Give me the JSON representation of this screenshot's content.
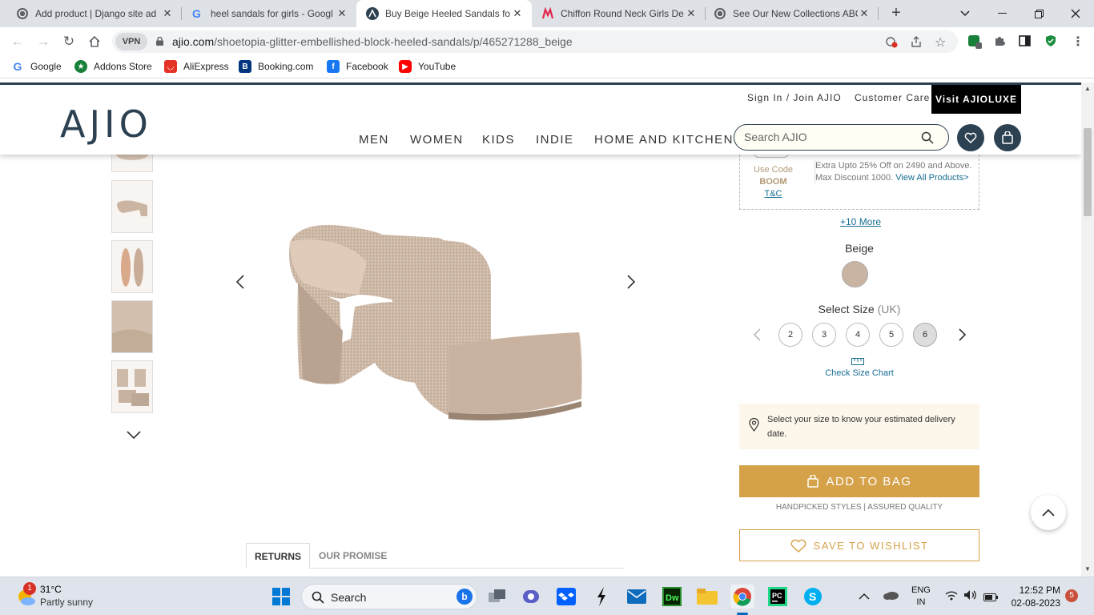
{
  "browser": {
    "tabs": [
      {
        "title": "Add product | Django site ad",
        "icon": "globe-icon"
      },
      {
        "title": "heel sandals for girls - Googl",
        "icon": "google-icon"
      },
      {
        "title": "Buy Beige Heeled Sandals for",
        "icon": "ajio-icon"
      },
      {
        "title": "Chiffon Round Neck Girls De",
        "icon": "myntra-icon"
      },
      {
        "title": "See Our New Collections ABC",
        "icon": "globe-icon"
      }
    ],
    "vpn_label": "VPN",
    "url_domain": "ajio.com",
    "url_path": "/shoetopia-glitter-embellished-block-heeled-sandals/p/465271288_beige",
    "bookmarks": [
      {
        "label": "Google"
      },
      {
        "label": "Addons Store"
      },
      {
        "label": "AliExpress"
      },
      {
        "label": "Booking.com"
      },
      {
        "label": "Facebook"
      },
      {
        "label": "YouTube"
      }
    ]
  },
  "header": {
    "logo": "AJIO",
    "sign_in": "Sign In / Join AJIO",
    "customer_care": "Customer Care",
    "luxe": "Visit AJIOLUXE",
    "menu": [
      "MEN",
      "WOMEN",
      "KIDS",
      "INDIE",
      "HOME AND KITCHEN"
    ],
    "search_placeholder": "Search AJIO"
  },
  "offer": {
    "code_line1": "Use Code",
    "code_line2": "BOOM",
    "tc": "T&C",
    "text": "Extra Upto 25% Off on 2490 and Above. Max Discount 1000.",
    "link": "View All Products>",
    "more": "+10 More"
  },
  "product": {
    "color_label": "Beige",
    "size_label": "Select Size",
    "size_unit": "(UK)",
    "sizes": [
      "2",
      "3",
      "4",
      "5",
      "6"
    ],
    "selected_size": "6",
    "size_chart": "Check Size Chart",
    "delivery_text": "Select your size to know your estimated delivery date.",
    "add_to_bag": "ADD TO BAG",
    "tagline": "HANDPICKED STYLES | ASSURED QUALITY",
    "save_wishlist": "SAVE TO WISHLIST"
  },
  "info_tabs": [
    "RETURNS",
    "OUR PROMISE"
  ],
  "taskbar": {
    "weather_temp": "31°C",
    "weather_desc": "Partly sunny",
    "weather_badge": "1",
    "search_label": "Search",
    "lang1": "ENG",
    "lang2": "IN",
    "time": "12:52 PM",
    "date": "02-08-2023",
    "notif": "5"
  }
}
